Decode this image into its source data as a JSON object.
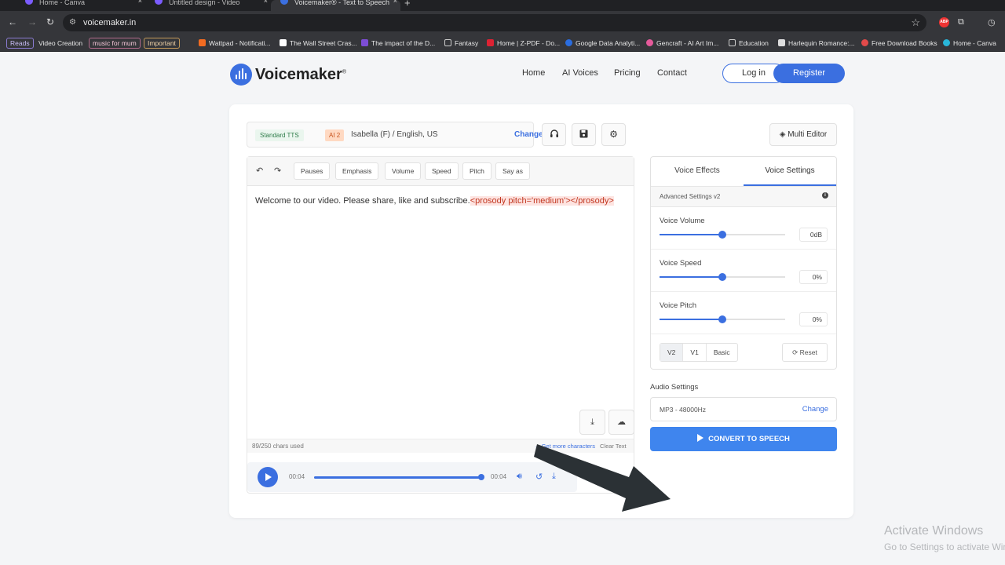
{
  "browser": {
    "tabs": [
      {
        "title": "Home - Canva"
      },
      {
        "title": "Untitled design - Video"
      },
      {
        "title": "Voicemaker® - Text to Speech"
      }
    ],
    "url": "voicemaker.in",
    "bookmarks": [
      {
        "label": "Reads",
        "tag": true
      },
      {
        "label": "Video Creation",
        "tag": false
      },
      {
        "label": "music for mum",
        "tag": true
      },
      {
        "label": "Important",
        "tag": true
      },
      {
        "label": "Wattpad - Notificati...",
        "tag": false
      },
      {
        "label": "The Wall Street Cras...",
        "tag": false
      },
      {
        "label": "The impact of the D...",
        "tag": false
      },
      {
        "label": "Fantasy",
        "tag": false
      },
      {
        "label": "Home | Z-PDF - Do...",
        "tag": false
      },
      {
        "label": "Google Data Analyti...",
        "tag": false
      },
      {
        "label": "Gencraft - AI Art Im...",
        "tag": false
      },
      {
        "label": "Education",
        "tag": false
      },
      {
        "label": "Harlequin Romance:...",
        "tag": false
      },
      {
        "label": "Free Download Books",
        "tag": false
      },
      {
        "label": "Home - Canva",
        "tag": false
      }
    ],
    "abp_label": "ABP"
  },
  "header": {
    "brand": "Voicemaker",
    "brand_mark": "®",
    "nav": [
      "Home",
      "AI Voices",
      "Pricing",
      "Contact"
    ],
    "login": "Log in",
    "register": "Register"
  },
  "voice": {
    "engine": "Standard TTS",
    "ai_badge": "AI 2",
    "name": "Isabella (F) / English, US",
    "change": "Change"
  },
  "toolbar": {
    "multi_editor": "Multi Editor",
    "buttons": [
      "Pauses",
      "Emphasis",
      "Volume",
      "Speed",
      "Pitch",
      "Say as"
    ]
  },
  "editor": {
    "text": "Welcome to our video. Please share, like and subscribe.",
    "ssml": "<prosody pitch='medium'></prosody>",
    "chars_used": "89/250 chars used",
    "get_more": "→ Get more characters",
    "clear_text": "Clear Text"
  },
  "player": {
    "current_time": "00:04",
    "duration": "00:04",
    "progress": 1.0
  },
  "settings": {
    "tabs": [
      "Voice Effects",
      "Voice Settings"
    ],
    "active_tab": "Voice Settings",
    "advanced_label": "Advanced Settings v2",
    "info_glyph": "i",
    "rows": [
      {
        "label": "Voice Volume",
        "value": "0dB",
        "level": 0.5
      },
      {
        "label": "Voice Speed",
        "value": "0%",
        "level": 0.5
      },
      {
        "label": "Voice Pitch",
        "value": "0%",
        "level": 0.5
      }
    ],
    "versions": [
      "V2",
      "V1",
      "Basic"
    ],
    "active_version": "V2",
    "reset": "Reset"
  },
  "audio": {
    "label": "Audio Settings",
    "format": "MP3 - 48000Hz",
    "change": "Change",
    "convert": "CONVERT TO SPEECH"
  },
  "watermark": {
    "line1": "Activate Windows",
    "line2": "Go to Settings to activate Windows."
  },
  "colors": {
    "accent": "#3b6fe0",
    "convert": "#3f85ee",
    "arrow": "#2b3135"
  }
}
